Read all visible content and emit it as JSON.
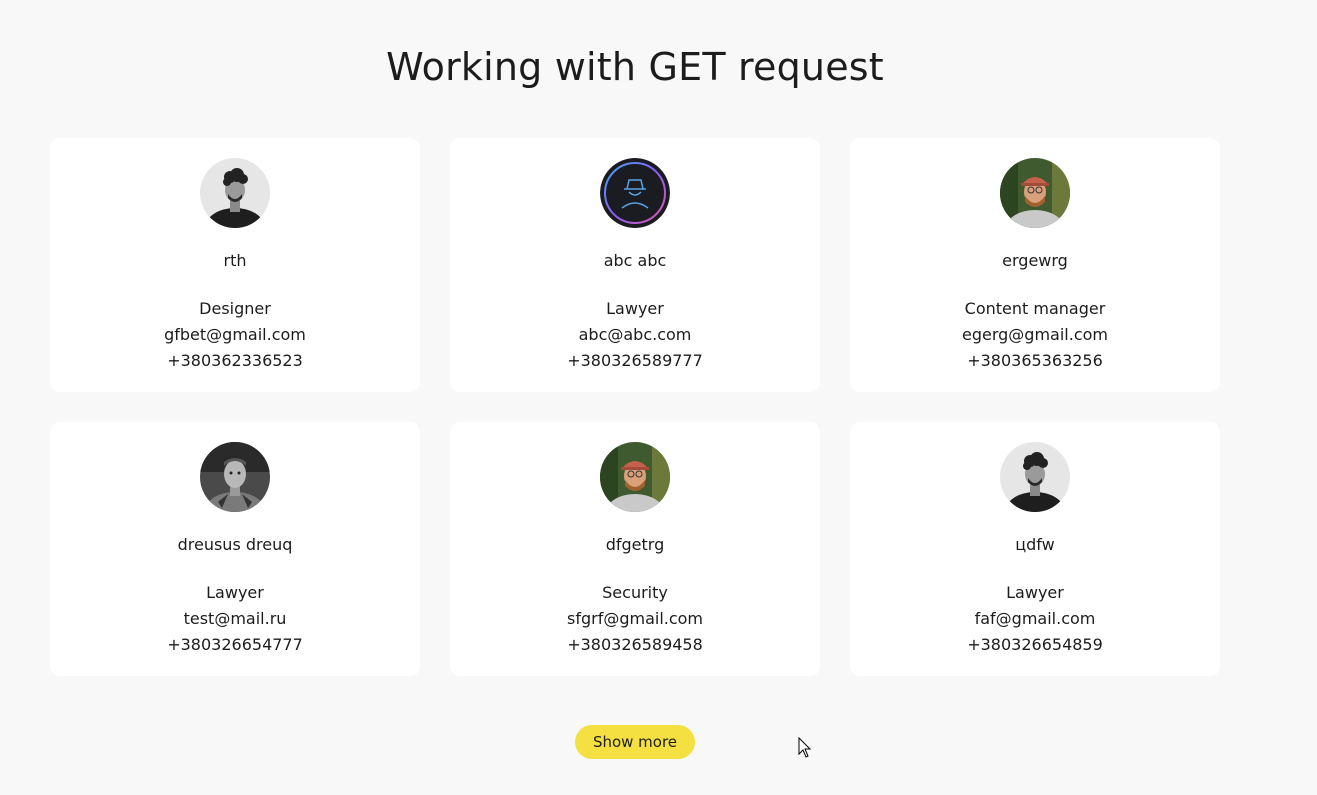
{
  "page": {
    "title": "Working with GET request",
    "show_more_label": "Show more"
  },
  "users": [
    {
      "name": "rth",
      "position": "Designer",
      "email": "gfbet@gmail.com",
      "phone": "+380362336523",
      "avatar_icon": "portrait-curly-hair-gray"
    },
    {
      "name": "abc abc",
      "position": "Lawyer",
      "email": "abc@abc.com",
      "phone": "+380326589777",
      "avatar_icon": "incognito-hat-icon"
    },
    {
      "name": "ergewrg",
      "position": "Content manager",
      "email": "egerg@gmail.com",
      "phone": "+380365363256",
      "avatar_icon": "portrait-red-cap"
    },
    {
      "name": "dreusus dreuq",
      "position": "Lawyer",
      "email": "test@mail.ru",
      "phone": "+380326654777",
      "avatar_icon": "portrait-bw-tattoo"
    },
    {
      "name": "dfgetrg",
      "position": "Security",
      "email": "sfgrf@gmail.com",
      "phone": "+380326589458",
      "avatar_icon": "portrait-red-cap"
    },
    {
      "name": "цdfw",
      "position": "Lawyer",
      "email": "faf@gmail.com",
      "phone": "+380326654859",
      "avatar_icon": "portrait-curly-hair-gray"
    }
  ],
  "colors": {
    "background": "#f8f8f8",
    "card": "#ffffff",
    "button": "#f4e041",
    "text": "#1c1c1c"
  }
}
